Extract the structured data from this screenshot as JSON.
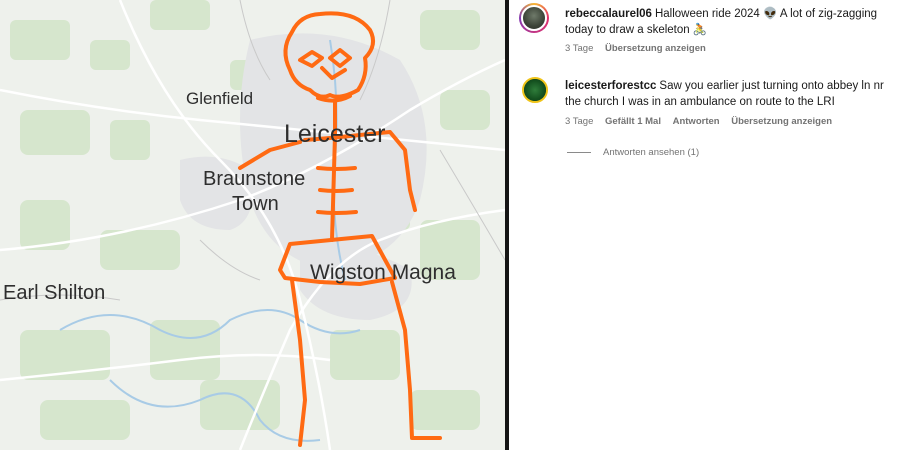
{
  "map": {
    "place_labels": {
      "glenfield": "Glenfield",
      "leicester": "Leicester",
      "braunstone_line1": "Braunstone",
      "braunstone_line2": "Town",
      "wigston": "Wigston Magna",
      "earl_shilton": "Earl Shilton"
    },
    "route_color": "#ff6a13"
  },
  "comments": [
    {
      "username": "rebeccalaurel06",
      "text": "Halloween ride 2024 👽 A lot of zig-zagging today to draw a skeleton 🚴",
      "time": "3 Tage",
      "actions": [
        "Übersetzung anzeigen"
      ],
      "avatar_icon": "profile-photo"
    },
    {
      "username": "leicesterforestcc",
      "text": "Saw you earlier just turning onto abbey ln nr the church I was in an ambulance on route to the LRI",
      "time": "3 Tage",
      "actions": [
        "Gefällt 1 Mal",
        "Antworten",
        "Übersetzung anzeigen"
      ],
      "avatar_icon": "club-badge"
    }
  ],
  "view_replies": "Antworten ansehen (1)"
}
